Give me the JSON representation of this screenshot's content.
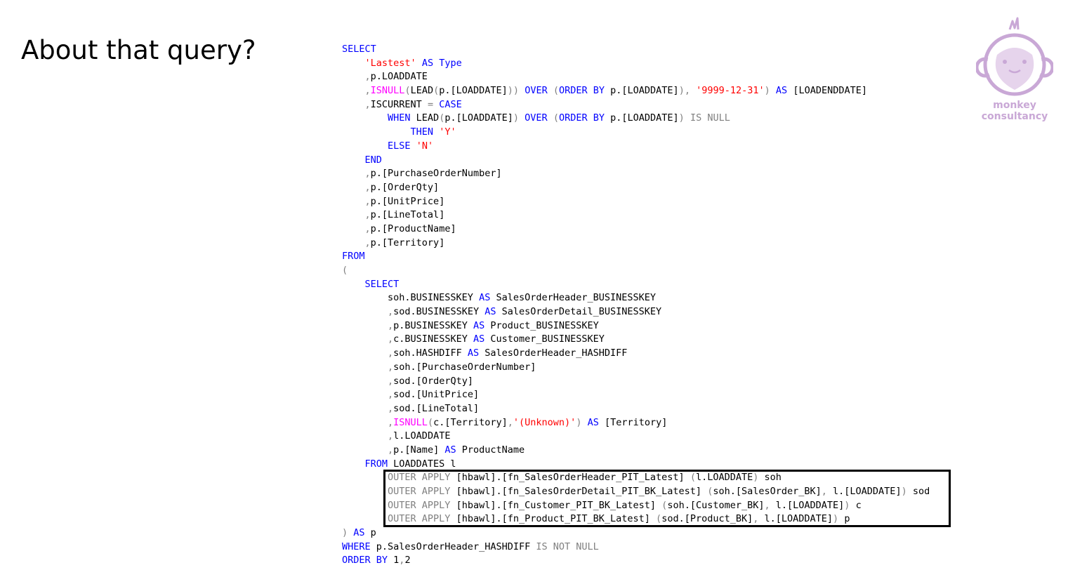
{
  "slide": {
    "title": "About that query?"
  },
  "logo": {
    "line1": "monkey",
    "line2": "consultancy",
    "color": "#c9a8d6"
  },
  "code": {
    "lines": [
      [
        {
          "t": "SELECT",
          "c": "kw"
        }
      ],
      [
        {
          "t": "    "
        },
        {
          "t": "'Lastest'",
          "c": "str"
        },
        {
          "t": " "
        },
        {
          "t": "AS",
          "c": "kw"
        },
        {
          "t": " "
        },
        {
          "t": "Type",
          "c": "kw"
        }
      ],
      [
        {
          "t": "    "
        },
        {
          "t": ",",
          "c": "op"
        },
        {
          "t": "p.LOADDATE"
        }
      ],
      [
        {
          "t": "    "
        },
        {
          "t": ",",
          "c": "op"
        },
        {
          "t": "ISNULL",
          "c": "fn"
        },
        {
          "t": "(",
          "c": "op"
        },
        {
          "t": "LEAD"
        },
        {
          "t": "(",
          "c": "op"
        },
        {
          "t": "p.[LOADDATE]"
        },
        {
          "t": "))",
          "c": "op"
        },
        {
          "t": " "
        },
        {
          "t": "OVER",
          "c": "kw"
        },
        {
          "t": " "
        },
        {
          "t": "(",
          "c": "op"
        },
        {
          "t": "ORDER BY",
          "c": "kw"
        },
        {
          "t": " p.[LOADDATE]"
        },
        {
          "t": "),",
          "c": "op"
        },
        {
          "t": " "
        },
        {
          "t": "'9999-12-31'",
          "c": "str"
        },
        {
          "t": ")",
          "c": "op"
        },
        {
          "t": " "
        },
        {
          "t": "AS",
          "c": "kw"
        },
        {
          "t": " [LOADENDDATE]"
        }
      ],
      [
        {
          "t": "    "
        },
        {
          "t": ",",
          "c": "op"
        },
        {
          "t": "ISCURRENT "
        },
        {
          "t": "=",
          "c": "op"
        },
        {
          "t": " "
        },
        {
          "t": "CASE",
          "c": "kw"
        }
      ],
      [
        {
          "t": "        "
        },
        {
          "t": "WHEN",
          "c": "kw"
        },
        {
          "t": " LEAD"
        },
        {
          "t": "(",
          "c": "op"
        },
        {
          "t": "p.[LOADDATE]"
        },
        {
          "t": ")",
          "c": "op"
        },
        {
          "t": " "
        },
        {
          "t": "OVER",
          "c": "kw"
        },
        {
          "t": " "
        },
        {
          "t": "(",
          "c": "op"
        },
        {
          "t": "ORDER BY",
          "c": "kw"
        },
        {
          "t": " p.[LOADDATE]"
        },
        {
          "t": ")",
          "c": "op"
        },
        {
          "t": " "
        },
        {
          "t": "IS NULL",
          "c": "op"
        }
      ],
      [
        {
          "t": "            "
        },
        {
          "t": "THEN",
          "c": "kw"
        },
        {
          "t": " "
        },
        {
          "t": "'Y'",
          "c": "str"
        }
      ],
      [
        {
          "t": "        "
        },
        {
          "t": "ELSE",
          "c": "kw"
        },
        {
          "t": " "
        },
        {
          "t": "'N'",
          "c": "str"
        }
      ],
      [
        {
          "t": "    "
        },
        {
          "t": "END",
          "c": "kw"
        }
      ],
      [
        {
          "t": "    "
        },
        {
          "t": ",",
          "c": "op"
        },
        {
          "t": "p.[PurchaseOrderNumber]"
        }
      ],
      [
        {
          "t": "    "
        },
        {
          "t": ",",
          "c": "op"
        },
        {
          "t": "p.[OrderQty]"
        }
      ],
      [
        {
          "t": "    "
        },
        {
          "t": ",",
          "c": "op"
        },
        {
          "t": "p.[UnitPrice]"
        }
      ],
      [
        {
          "t": "    "
        },
        {
          "t": ",",
          "c": "op"
        },
        {
          "t": "p.[LineTotal]"
        }
      ],
      [
        {
          "t": "    "
        },
        {
          "t": ",",
          "c": "op"
        },
        {
          "t": "p.[ProductName]"
        }
      ],
      [
        {
          "t": "    "
        },
        {
          "t": ",",
          "c": "op"
        },
        {
          "t": "p.[Territory]"
        }
      ],
      [
        {
          "t": "FROM",
          "c": "kw"
        }
      ],
      [
        {
          "t": "(",
          "c": "op"
        }
      ],
      [
        {
          "t": "    "
        },
        {
          "t": "SELECT",
          "c": "kw"
        }
      ],
      [
        {
          "t": "        soh.BUSINESSKEY "
        },
        {
          "t": "AS",
          "c": "kw"
        },
        {
          "t": " SalesOrderHeader_BUSINESSKEY"
        }
      ],
      [
        {
          "t": "        "
        },
        {
          "t": ",",
          "c": "op"
        },
        {
          "t": "sod.BUSINESSKEY "
        },
        {
          "t": "AS",
          "c": "kw"
        },
        {
          "t": " SalesOrderDetail_BUSINESSKEY"
        }
      ],
      [
        {
          "t": "        "
        },
        {
          "t": ",",
          "c": "op"
        },
        {
          "t": "p.BUSINESSKEY "
        },
        {
          "t": "AS",
          "c": "kw"
        },
        {
          "t": " Product_BUSINESSKEY"
        }
      ],
      [
        {
          "t": "        "
        },
        {
          "t": ",",
          "c": "op"
        },
        {
          "t": "c.BUSINESSKEY "
        },
        {
          "t": "AS",
          "c": "kw"
        },
        {
          "t": " Customer_BUSINESSKEY"
        }
      ],
      [
        {
          "t": "        "
        },
        {
          "t": ",",
          "c": "op"
        },
        {
          "t": "soh.HASHDIFF "
        },
        {
          "t": "AS",
          "c": "kw"
        },
        {
          "t": " SalesOrderHeader_HASHDIFF"
        }
      ],
      [
        {
          "t": "        "
        },
        {
          "t": ",",
          "c": "op"
        },
        {
          "t": "soh.[PurchaseOrderNumber]"
        }
      ],
      [
        {
          "t": "        "
        },
        {
          "t": ",",
          "c": "op"
        },
        {
          "t": "sod.[OrderQty]"
        }
      ],
      [
        {
          "t": "        "
        },
        {
          "t": ",",
          "c": "op"
        },
        {
          "t": "sod.[UnitPrice]"
        }
      ],
      [
        {
          "t": "        "
        },
        {
          "t": ",",
          "c": "op"
        },
        {
          "t": "sod.[LineTotal]"
        }
      ],
      [
        {
          "t": "        "
        },
        {
          "t": ",",
          "c": "op"
        },
        {
          "t": "ISNULL",
          "c": "fn"
        },
        {
          "t": "(",
          "c": "op"
        },
        {
          "t": "c.[Territory]"
        },
        {
          "t": ",",
          "c": "op"
        },
        {
          "t": "'(Unknown)'",
          "c": "str"
        },
        {
          "t": ")",
          "c": "op"
        },
        {
          "t": " "
        },
        {
          "t": "AS",
          "c": "kw"
        },
        {
          "t": " [Territory]"
        }
      ],
      [
        {
          "t": "        "
        },
        {
          "t": ",",
          "c": "op"
        },
        {
          "t": "l.LOADDATE"
        }
      ],
      [
        {
          "t": "        "
        },
        {
          "t": ",",
          "c": "op"
        },
        {
          "t": "p.[Name] "
        },
        {
          "t": "AS",
          "c": "kw"
        },
        {
          "t": " ProductName"
        }
      ],
      [
        {
          "t": "    "
        },
        {
          "t": "FROM",
          "c": "kw"
        },
        {
          "t": " LOADDATES l"
        }
      ],
      [
        {
          "t": "        "
        },
        {
          "t": "OUTER APPLY",
          "c": "op"
        },
        {
          "t": " [hbawl].[fn_SalesOrderHeader_PIT_Latest] "
        },
        {
          "t": "(",
          "c": "op"
        },
        {
          "t": "l.LOADDATE"
        },
        {
          "t": ")",
          "c": "op"
        },
        {
          "t": " soh"
        }
      ],
      [
        {
          "t": "        "
        },
        {
          "t": "OUTER APPLY",
          "c": "op"
        },
        {
          "t": " [hbawl].[fn_SalesOrderDetail_PIT_BK_Latest] "
        },
        {
          "t": "(",
          "c": "op"
        },
        {
          "t": "soh.[SalesOrder_BK]"
        },
        {
          "t": ",",
          "c": "op"
        },
        {
          "t": " l.[LOADDATE]"
        },
        {
          "t": ")",
          "c": "op"
        },
        {
          "t": " sod"
        }
      ],
      [
        {
          "t": "        "
        },
        {
          "t": "OUTER APPLY",
          "c": "op"
        },
        {
          "t": " [hbawl].[fn_Customer_PIT_BK_Latest] "
        },
        {
          "t": "(",
          "c": "op"
        },
        {
          "t": "soh.[Customer_BK]"
        },
        {
          "t": ",",
          "c": "op"
        },
        {
          "t": " l.[LOADDATE]"
        },
        {
          "t": ")",
          "c": "op"
        },
        {
          "t": " c"
        }
      ],
      [
        {
          "t": "        "
        },
        {
          "t": "OUTER APPLY",
          "c": "op"
        },
        {
          "t": " [hbawl].[fn_Product_PIT_BK_Latest] "
        },
        {
          "t": "(",
          "c": "op"
        },
        {
          "t": "sod.[Product_BK]"
        },
        {
          "t": ",",
          "c": "op"
        },
        {
          "t": " l.[LOADDATE]"
        },
        {
          "t": ")",
          "c": "op"
        },
        {
          "t": " p"
        }
      ],
      [
        {
          "t": ")",
          "c": "op"
        },
        {
          "t": " "
        },
        {
          "t": "AS",
          "c": "kw"
        },
        {
          "t": " p"
        }
      ],
      [
        {
          "t": "WHERE",
          "c": "kw"
        },
        {
          "t": " p.SalesOrderHeader_HASHDIFF "
        },
        {
          "t": "IS NOT NULL",
          "c": "op"
        }
      ],
      [
        {
          "t": "ORDER BY",
          "c": "kw"
        },
        {
          "t": " 1"
        },
        {
          "t": ",",
          "c": "op"
        },
        {
          "t": "2"
        }
      ]
    ]
  }
}
